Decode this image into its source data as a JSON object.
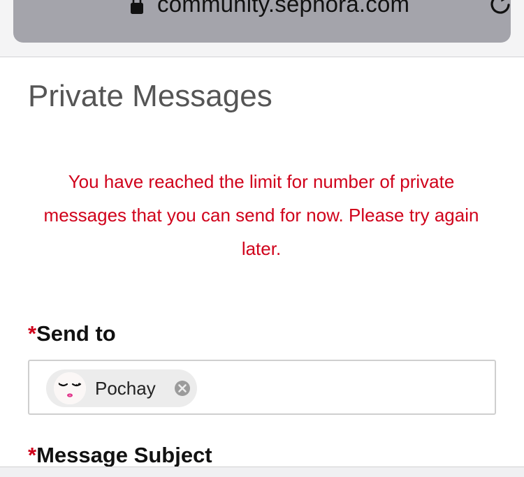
{
  "browser": {
    "url": "community.sephora.com",
    "lock_icon": "lock-icon",
    "reload_icon": "reload-icon"
  },
  "page": {
    "title": "Private Messages",
    "error_message": "You have reached the limit for number of private messages that you can send for now. Please try again later."
  },
  "form": {
    "required_marker": "*",
    "send_to_label": "Send to",
    "recipients": [
      {
        "name": "Pochay",
        "avatar_icon": "avatar-face-icon",
        "remove_icon": "remove-circle-icon"
      }
    ],
    "subject_label": "Message Subject"
  },
  "colors": {
    "error": "#d0021b",
    "required": "#d0021b",
    "url_pill": "#a4a4ab",
    "chip_background": "#ececec"
  }
}
